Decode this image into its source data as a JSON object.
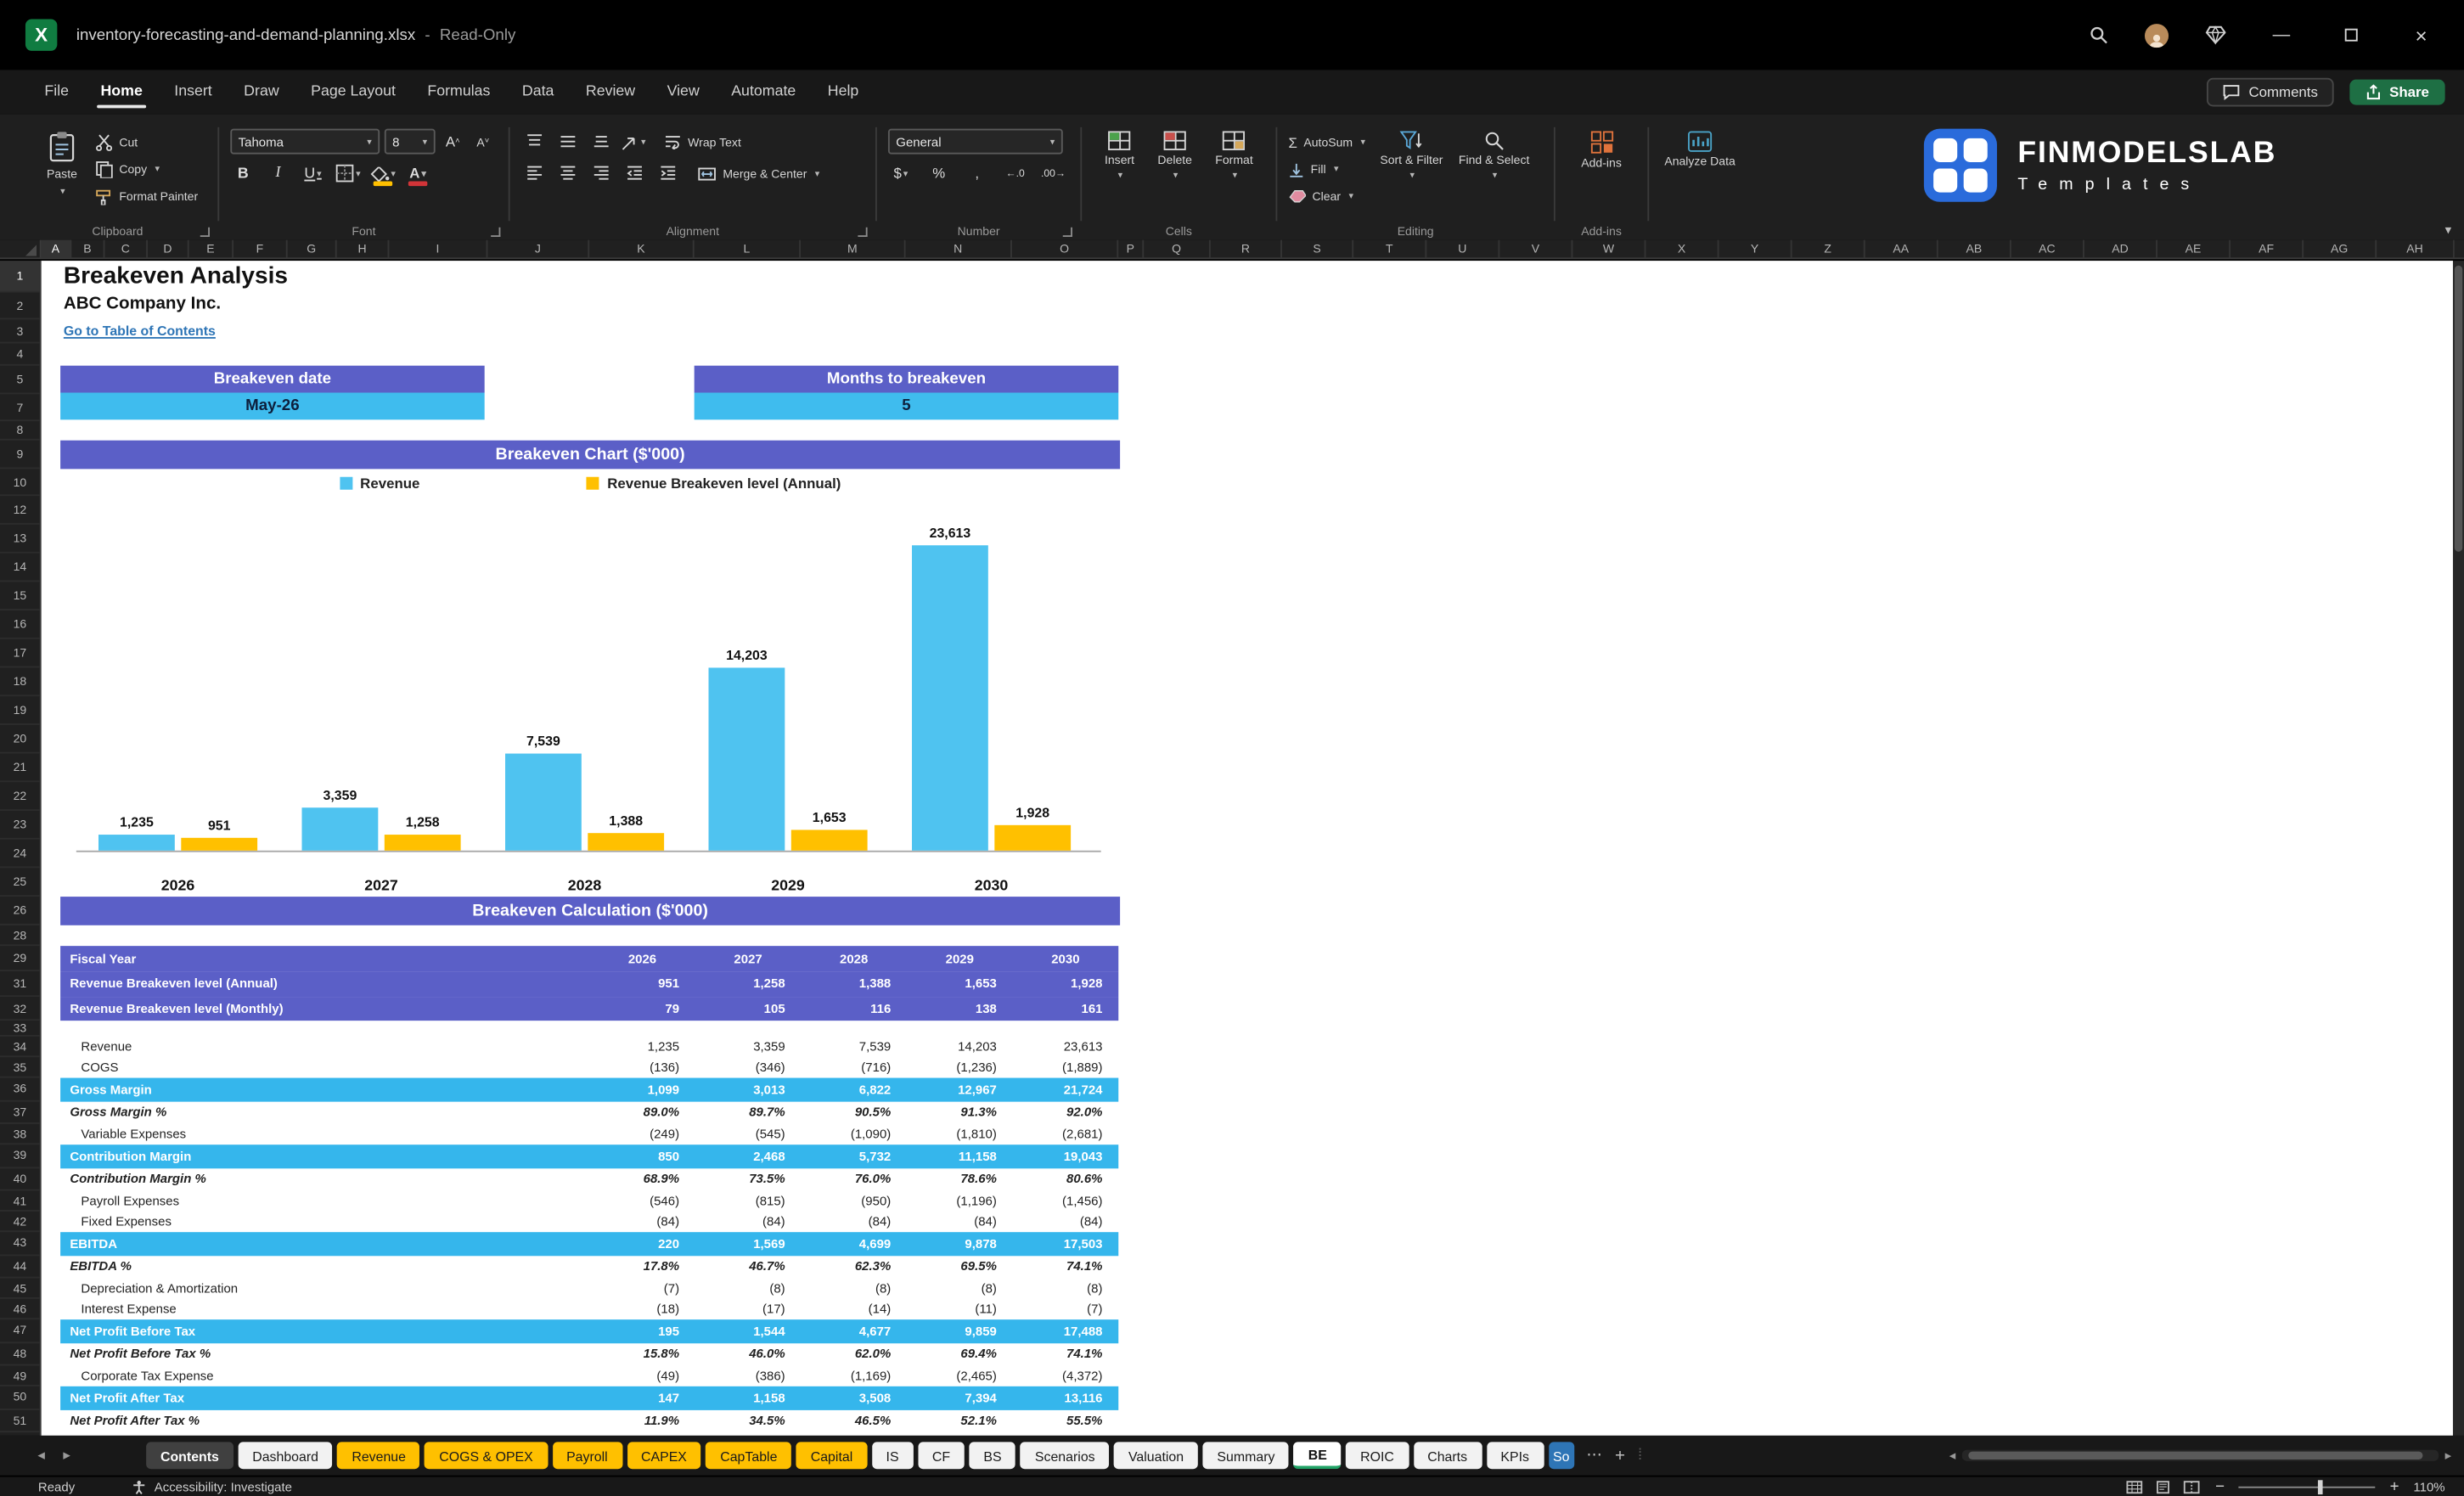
{
  "colors": {
    "accent_purple": "#5B5FC7",
    "accent_blue": "#3FBCEE",
    "accent_yellow": "#FFC000",
    "share_green": "#1E6F44",
    "link_blue": "#2E75B6"
  },
  "titlebar": {
    "filename": "inventory-forecasting-and-demand-planning.xlsx",
    "separator": "-",
    "mode": "Read-Only"
  },
  "menu": {
    "tabs": [
      "File",
      "Home",
      "Insert",
      "Draw",
      "Page Layout",
      "Formulas",
      "Data",
      "Review",
      "View",
      "Automate",
      "Help"
    ],
    "active": "Home",
    "comments_label": "Comments",
    "share_label": "Share"
  },
  "ribbon": {
    "clipboard": {
      "label": "Clipboard",
      "paste": "Paste",
      "cut": "Cut",
      "copy": "Copy",
      "format_painter": "Format Painter"
    },
    "font": {
      "label": "Font",
      "family": "Tahoma",
      "size": "8",
      "bold": "B",
      "italic": "I",
      "underline": "U"
    },
    "alignment": {
      "label": "Alignment",
      "wrap": "Wrap Text",
      "merge": "Merge & Center"
    },
    "number": {
      "label": "Number",
      "format": "General",
      "currency": "$",
      "percent": "%",
      "comma": ",",
      "inc_decimal": "←.0",
      "dec_decimal": ".00→"
    },
    "cells": {
      "label": "Cells",
      "insert": "Insert",
      "delete": "Delete",
      "format": "Format"
    },
    "editing": {
      "label": "Editing",
      "autosum": "AutoSum",
      "fill": "Fill",
      "clear": "Clear",
      "sort": "Sort & Filter",
      "find": "Find & Select"
    },
    "addins": {
      "label": "Add-ins",
      "button": "Add-ins",
      "analyze": "Analyze Data"
    },
    "brand": {
      "name": "FINMODELSLAB",
      "sub": "Templates"
    }
  },
  "grid": {
    "columns": [
      "A",
      "B",
      "C",
      "D",
      "E",
      "F",
      "G",
      "H",
      "I",
      "J",
      "K",
      "L",
      "M",
      "N",
      "O",
      "P",
      "Q",
      "R",
      "S",
      "T",
      "U",
      "V",
      "W",
      "X",
      "Y",
      "Z",
      "AA",
      "AB",
      "AC",
      "AD",
      "AE",
      "AF",
      "AG",
      "AH"
    ],
    "rows": [
      1,
      2,
      3,
      4,
      5,
      7,
      8,
      9,
      10,
      12,
      13,
      14,
      15,
      16,
      17,
      18,
      19,
      20,
      21,
      22,
      23,
      24,
      25,
      26,
      28,
      29,
      31,
      32,
      33,
      34,
      35,
      36,
      37,
      38,
      39,
      40,
      41,
      42,
      43,
      44,
      45,
      46,
      47,
      48,
      49,
      50,
      51
    ]
  },
  "sheet": {
    "title": "Breakeven Analysis",
    "company": "ABC Company Inc.",
    "link": "Go to Table of Contents",
    "kpi": [
      {
        "label": "Breakeven date",
        "value": "May-26"
      },
      {
        "label": "Months to breakeven",
        "value": "5"
      }
    ],
    "chart_banner": "Breakeven Chart ($'000)",
    "calc_banner": "Breakeven Calculation ($'000)"
  },
  "chart_data": {
    "type": "bar",
    "title": "Breakeven Chart ($'000)",
    "categories": [
      "2026",
      "2027",
      "2028",
      "2029",
      "2030"
    ],
    "series": [
      {
        "name": "Revenue",
        "color": "#4FC3F0",
        "values": [
          1235,
          3359,
          7539,
          14203,
          23613
        ],
        "labels": [
          "1,235",
          "3,359",
          "7,539",
          "14,203",
          "23,613"
        ]
      },
      {
        "name": "Revenue Breakeven level (Annual)",
        "color": "#FFC000",
        "values": [
          951,
          1258,
          1388,
          1653,
          1928
        ],
        "labels": [
          "951",
          "1,258",
          "1,388",
          "1,653",
          "1,928"
        ]
      }
    ],
    "ylim": [
      0,
      25000
    ],
    "grid": false,
    "legend_position": "top"
  },
  "calc_table": {
    "header": {
      "label": "Fiscal Year",
      "years": [
        "2026",
        "2027",
        "2028",
        "2029",
        "2030"
      ]
    },
    "rows": [
      {
        "label": "Revenue Breakeven level (Annual)",
        "style": "purple",
        "values": [
          "951",
          "1,258",
          "1,388",
          "1,653",
          "1,928"
        ]
      },
      {
        "label": "Revenue Breakeven level (Monthly)",
        "style": "purple",
        "values": [
          "79",
          "105",
          "116",
          "138",
          "161"
        ]
      },
      {
        "label": "",
        "style": "spacer",
        "values": []
      },
      {
        "label": "Revenue",
        "style": "plain",
        "values": [
          "1,235",
          "3,359",
          "7,539",
          "14,203",
          "23,613"
        ]
      },
      {
        "label": "COGS",
        "style": "plain",
        "values": [
          "(136)",
          "(346)",
          "(716)",
          "(1,236)",
          "(1,889)"
        ]
      },
      {
        "label": "Gross Margin",
        "style": "blue",
        "values": [
          "1,099",
          "3,013",
          "6,822",
          "12,967",
          "21,724"
        ]
      },
      {
        "label": "Gross Margin %",
        "style": "pct",
        "values": [
          "89.0%",
          "89.7%",
          "90.5%",
          "91.3%",
          "92.0%"
        ]
      },
      {
        "label": "Variable Expenses",
        "style": "plain",
        "values": [
          "(249)",
          "(545)",
          "(1,090)",
          "(1,810)",
          "(2,681)"
        ]
      },
      {
        "label": "Contribution Margin",
        "style": "blue",
        "values": [
          "850",
          "2,468",
          "5,732",
          "11,158",
          "19,043"
        ]
      },
      {
        "label": "Contribution Margin %",
        "style": "pct",
        "values": [
          "68.9%",
          "73.5%",
          "76.0%",
          "78.6%",
          "80.6%"
        ]
      },
      {
        "label": "Payroll Expenses",
        "style": "plain",
        "values": [
          "(546)",
          "(815)",
          "(950)",
          "(1,196)",
          "(1,456)"
        ]
      },
      {
        "label": "Fixed Expenses",
        "style": "plain",
        "values": [
          "(84)",
          "(84)",
          "(84)",
          "(84)",
          "(84)"
        ]
      },
      {
        "label": "EBITDA",
        "style": "blue",
        "values": [
          "220",
          "1,569",
          "4,699",
          "9,878",
          "17,503"
        ]
      },
      {
        "label": "EBITDA %",
        "style": "pct",
        "values": [
          "17.8%",
          "46.7%",
          "62.3%",
          "69.5%",
          "74.1%"
        ]
      },
      {
        "label": "Depreciation & Amortization",
        "style": "plain",
        "values": [
          "(7)",
          "(8)",
          "(8)",
          "(8)",
          "(8)"
        ]
      },
      {
        "label": "Interest Expense",
        "style": "plain",
        "values": [
          "(18)",
          "(17)",
          "(14)",
          "(11)",
          "(7)"
        ]
      },
      {
        "label": "Net Profit Before Tax",
        "style": "blue",
        "values": [
          "195",
          "1,544",
          "4,677",
          "9,859",
          "17,488"
        ]
      },
      {
        "label": "Net Profit Before Tax %",
        "style": "pct",
        "values": [
          "15.8%",
          "46.0%",
          "62.0%",
          "69.4%",
          "74.1%"
        ]
      },
      {
        "label": "Corporate Tax Expense",
        "style": "plain",
        "values": [
          "(49)",
          "(386)",
          "(1,169)",
          "(2,465)",
          "(4,372)"
        ]
      },
      {
        "label": "Net Profit After Tax",
        "style": "blue",
        "values": [
          "147",
          "1,158",
          "3,508",
          "7,394",
          "13,116"
        ]
      },
      {
        "label": "Net Profit After Tax %",
        "style": "pct",
        "values": [
          "11.9%",
          "34.5%",
          "46.5%",
          "52.1%",
          "55.5%"
        ]
      }
    ]
  },
  "tabs": {
    "items": [
      {
        "label": "Contents",
        "style": "dark"
      },
      {
        "label": "Dashboard",
        "style": "white"
      },
      {
        "label": "Revenue",
        "style": "yellow"
      },
      {
        "label": "COGS & OPEX",
        "style": "yellow"
      },
      {
        "label": "Payroll",
        "style": "yellow"
      },
      {
        "label": "CAPEX",
        "style": "yellow"
      },
      {
        "label": "CapTable",
        "style": "yellow"
      },
      {
        "label": "Capital",
        "style": "yellow"
      },
      {
        "label": "IS",
        "style": "white"
      },
      {
        "label": "CF",
        "style": "white"
      },
      {
        "label": "BS",
        "style": "white"
      },
      {
        "label": "Scenarios",
        "style": "white"
      },
      {
        "label": "Valuation",
        "style": "white"
      },
      {
        "label": "Summary",
        "style": "white"
      },
      {
        "label": "BE",
        "style": "active"
      },
      {
        "label": "ROIC",
        "style": "white"
      },
      {
        "label": "Charts",
        "style": "white"
      },
      {
        "label": "KPIs",
        "style": "white"
      },
      {
        "label": "So",
        "style": "blue"
      }
    ]
  },
  "statusbar": {
    "ready": "Ready",
    "accessibility": "Accessibility: Investigate",
    "zoom": "110%"
  }
}
